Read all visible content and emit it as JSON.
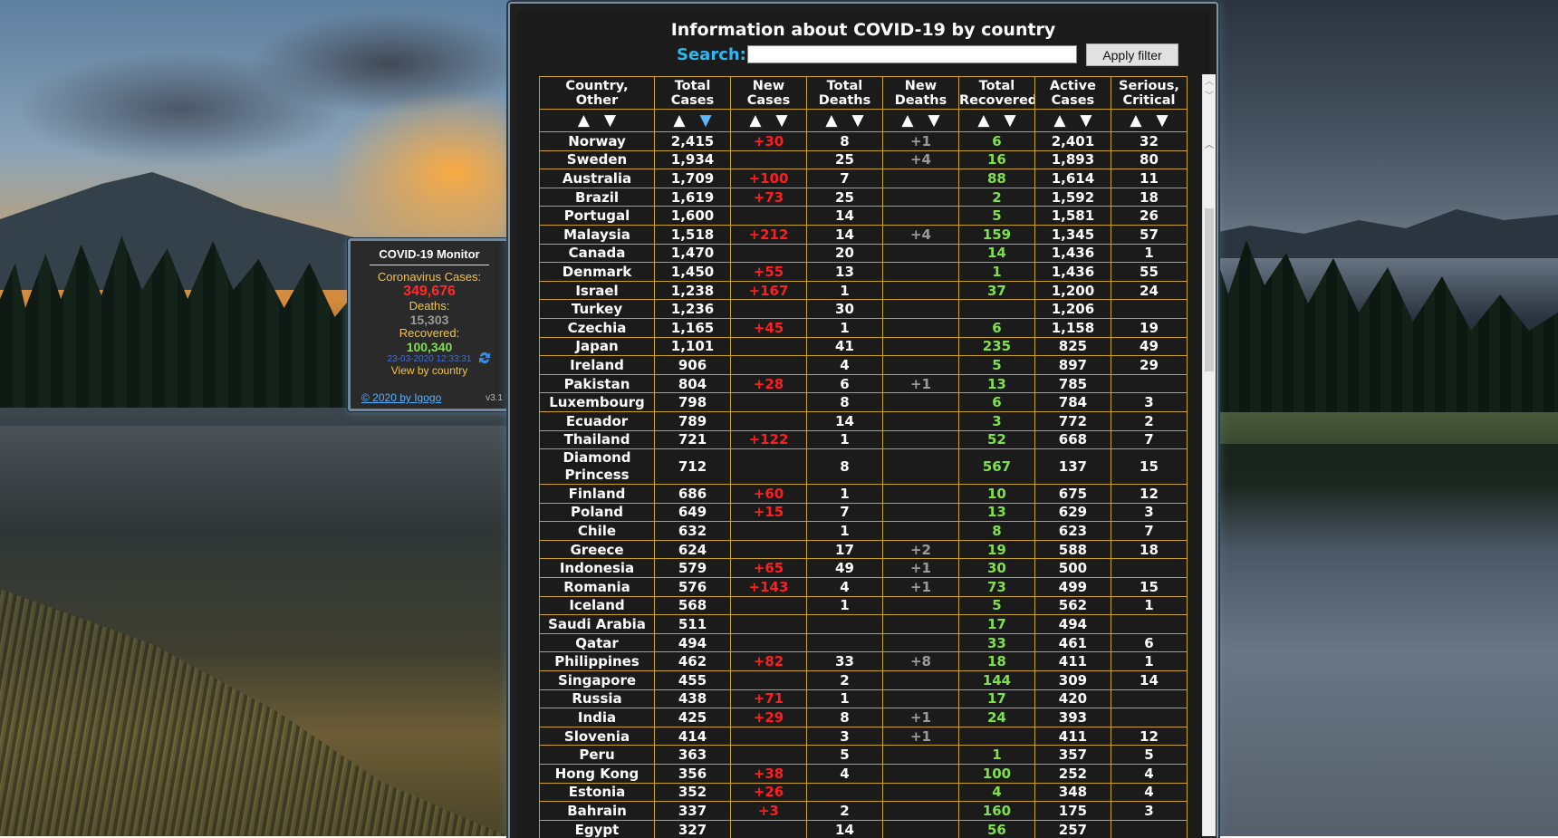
{
  "gadget": {
    "title": "COVID-19 Monitor",
    "cases_label": "Coronavirus Cases:",
    "cases": "349,676",
    "deaths_label": "Deaths:",
    "deaths": "15,303",
    "recovered_label": "Recovered:",
    "recovered": "100,340",
    "timestamp": "23-03-2020 12:33:31",
    "view_link": "View by country",
    "copyright": "© 2020 by Igogo",
    "version": "v3.1",
    "refresh_icon": "refresh-icon"
  },
  "window": {
    "title": "Information about COVID-19 by country",
    "search_label": "Search:",
    "search_value": "",
    "apply_label": "Apply filter"
  },
  "table": {
    "headers": [
      "Country,\nOther",
      "Total\nCases",
      "New\nCases",
      "Total\nDeaths",
      "New\nDeaths",
      "Total\nRecovered",
      "Active\nCases",
      "Serious,\nCritical"
    ],
    "sort_up": "▲",
    "sort_down": "▼",
    "active_sort": {
      "column": 1,
      "direction": "down"
    },
    "rows": [
      [
        "Norway",
        "2,415",
        "+30",
        "8",
        "+1",
        "6",
        "2,401",
        "32"
      ],
      [
        "Sweden",
        "1,934",
        "",
        "25",
        "+4",
        "16",
        "1,893",
        "80"
      ],
      [
        "Australia",
        "1,709",
        "+100",
        "7",
        "",
        "88",
        "1,614",
        "11"
      ],
      [
        "Brazil",
        "1,619",
        "+73",
        "25",
        "",
        "2",
        "1,592",
        "18"
      ],
      [
        "Portugal",
        "1,600",
        "",
        "14",
        "",
        "5",
        "1,581",
        "26"
      ],
      [
        "Malaysia",
        "1,518",
        "+212",
        "14",
        "+4",
        "159",
        "1,345",
        "57"
      ],
      [
        "Canada",
        "1,470",
        "",
        "20",
        "",
        "14",
        "1,436",
        "1"
      ],
      [
        "Denmark",
        "1,450",
        "+55",
        "13",
        "",
        "1",
        "1,436",
        "55"
      ],
      [
        "Israel",
        "1,238",
        "+167",
        "1",
        "",
        "37",
        "1,200",
        "24"
      ],
      [
        "Turkey",
        "1,236",
        "",
        "30",
        "",
        "",
        "1,206",
        ""
      ],
      [
        "Czechia",
        "1,165",
        "+45",
        "1",
        "",
        "6",
        "1,158",
        "19"
      ],
      [
        "Japan",
        "1,101",
        "",
        "41",
        "",
        "235",
        "825",
        "49"
      ],
      [
        "Ireland",
        "906",
        "",
        "4",
        "",
        "5",
        "897",
        "29"
      ],
      [
        "Pakistan",
        "804",
        "+28",
        "6",
        "+1",
        "13",
        "785",
        ""
      ],
      [
        "Luxembourg",
        "798",
        "",
        "8",
        "",
        "6",
        "784",
        "3"
      ],
      [
        "Ecuador",
        "789",
        "",
        "14",
        "",
        "3",
        "772",
        "2"
      ],
      [
        "Thailand",
        "721",
        "+122",
        "1",
        "",
        "52",
        "668",
        "7"
      ],
      [
        "Diamond Princess",
        "712",
        "",
        "8",
        "",
        "567",
        "137",
        "15"
      ],
      [
        "Finland",
        "686",
        "+60",
        "1",
        "",
        "10",
        "675",
        "12"
      ],
      [
        "Poland",
        "649",
        "+15",
        "7",
        "",
        "13",
        "629",
        "3"
      ],
      [
        "Chile",
        "632",
        "",
        "1",
        "",
        "8",
        "623",
        "7"
      ],
      [
        "Greece",
        "624",
        "",
        "17",
        "+2",
        "19",
        "588",
        "18"
      ],
      [
        "Indonesia",
        "579",
        "+65",
        "49",
        "+1",
        "30",
        "500",
        ""
      ],
      [
        "Romania",
        "576",
        "+143",
        "4",
        "+1",
        "73",
        "499",
        "15"
      ],
      [
        "Iceland",
        "568",
        "",
        "1",
        "",
        "5",
        "562",
        "1"
      ],
      [
        "Saudi Arabia",
        "511",
        "",
        "",
        "",
        "17",
        "494",
        ""
      ],
      [
        "Qatar",
        "494",
        "",
        "",
        "",
        "33",
        "461",
        "6"
      ],
      [
        "Philippines",
        "462",
        "+82",
        "33",
        "+8",
        "18",
        "411",
        "1"
      ],
      [
        "Singapore",
        "455",
        "",
        "2",
        "",
        "144",
        "309",
        "14"
      ],
      [
        "Russia",
        "438",
        "+71",
        "1",
        "",
        "17",
        "420",
        ""
      ],
      [
        "India",
        "425",
        "+29",
        "8",
        "+1",
        "24",
        "393",
        ""
      ],
      [
        "Slovenia",
        "414",
        "",
        "3",
        "+1",
        "",
        "411",
        "12"
      ],
      [
        "Peru",
        "363",
        "",
        "5",
        "",
        "1",
        "357",
        "5"
      ],
      [
        "Hong Kong",
        "356",
        "+38",
        "4",
        "",
        "100",
        "252",
        "4"
      ],
      [
        "Estonia",
        "352",
        "+26",
        "",
        "",
        "4",
        "348",
        "4"
      ],
      [
        "Bahrain",
        "337",
        "+3",
        "2",
        "",
        "160",
        "175",
        "3"
      ],
      [
        "Egypt",
        "327",
        "",
        "14",
        "",
        "56",
        "257",
        ""
      ]
    ]
  },
  "colors": {
    "new_cases": "#ff1e1e",
    "new_deaths": "#9a9a9a",
    "recovered": "#7fe04a",
    "border": "#c8a227",
    "search_label": "#2eb7f0"
  }
}
